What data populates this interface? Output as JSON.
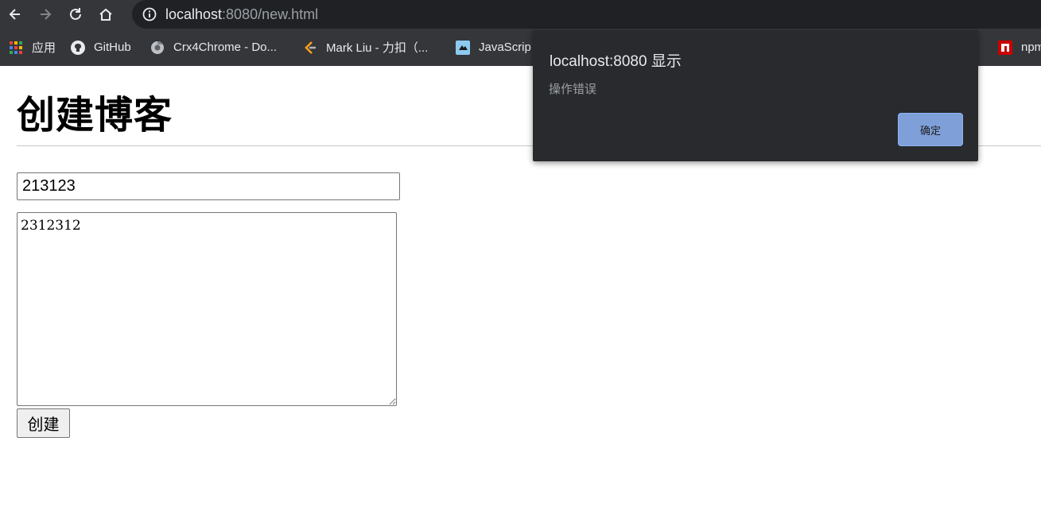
{
  "browser": {
    "url_host": "localhost",
    "url_rest": ":8080/new.html",
    "bookmarks": [
      {
        "label": "应用",
        "icon": "apps-grid-icon"
      },
      {
        "label": "GitHub",
        "icon": "github-icon"
      },
      {
        "label": "Crx4Chrome - Do...",
        "icon": "crx4chrome-icon"
      },
      {
        "label": "Mark Liu - 力扣（...",
        "icon": "leetcode-icon"
      },
      {
        "label": "JavaScrip",
        "icon": "javascript-bookmark-icon"
      },
      {
        "label": "npm",
        "icon": "npm-icon"
      }
    ]
  },
  "page": {
    "title": "创建博客",
    "title_input_value": "213123",
    "content_value": "2312312",
    "create_button": "创建"
  },
  "dialog": {
    "title": "localhost:8080 显示",
    "message": "操作错误",
    "ok_button": "确定"
  },
  "colors": {
    "toolbar_bg": "#35363a",
    "omnibox_bg": "#202124",
    "dialog_bg": "#292a2d",
    "dialog_button": "#7f9fd8"
  }
}
